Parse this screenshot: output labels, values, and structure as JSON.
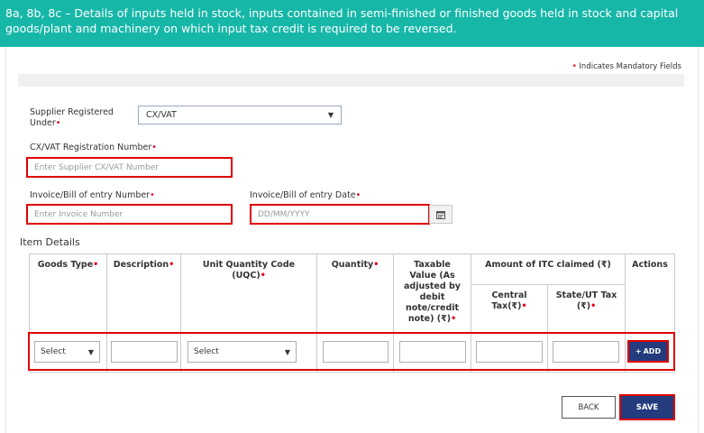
{
  "header": {
    "title_line1": "8a, 8b, 8c – Details of inputs held in stock, inputs contained in semi-finished or finished goods held in stock and capital",
    "title_line2": "goods/plant and machinery on which input tax credit is required to be reversed."
  },
  "mandatory_note": "Indicates Mandatory Fields",
  "form": {
    "supplier_registered_label_1": "Supplier Registered",
    "supplier_registered_label_2": "Under",
    "supplier_registered_value": "CX/VAT",
    "cxvat_label": "CX/VAT Registration Number",
    "cxvat_placeholder": "Enter Supplier CX/VAT Number",
    "invoice_label": "Invoice/Bill of entry Number",
    "invoice_placeholder": "Enter Invoice Number",
    "invoice_date_label": "Invoice/Bill of entry Date",
    "invoice_date_placeholder": "DD/MM/YYYY"
  },
  "item_details": {
    "title": "Item Details",
    "headers": {
      "goods_type": "Goods Type",
      "description": "Description",
      "uqc_1": "Unit Quantity Code",
      "uqc_2": "(UQC)",
      "quantity": "Quantity",
      "taxable_1": "Taxable",
      "taxable_2": "Value (As",
      "taxable_3": "adjusted by",
      "taxable_4": "debit",
      "taxable_5": "note/credit",
      "taxable_6": "note) (₹)",
      "itc": "Amount of ITC claimed (₹)",
      "central_1": "Central",
      "central_2": "Tax(₹)",
      "state_1": "State/UT Tax",
      "state_2": "(₹)",
      "actions": "Actions"
    },
    "row": {
      "goods_type_value": "Select",
      "uqc_value": "Select",
      "add_label": "ADD"
    }
  },
  "buttons": {
    "back": "BACK",
    "save": "SAVE"
  },
  "colors": {
    "header_bg": "#17b7a8",
    "primary_button": "#243b7e",
    "highlight": "#e00000"
  }
}
